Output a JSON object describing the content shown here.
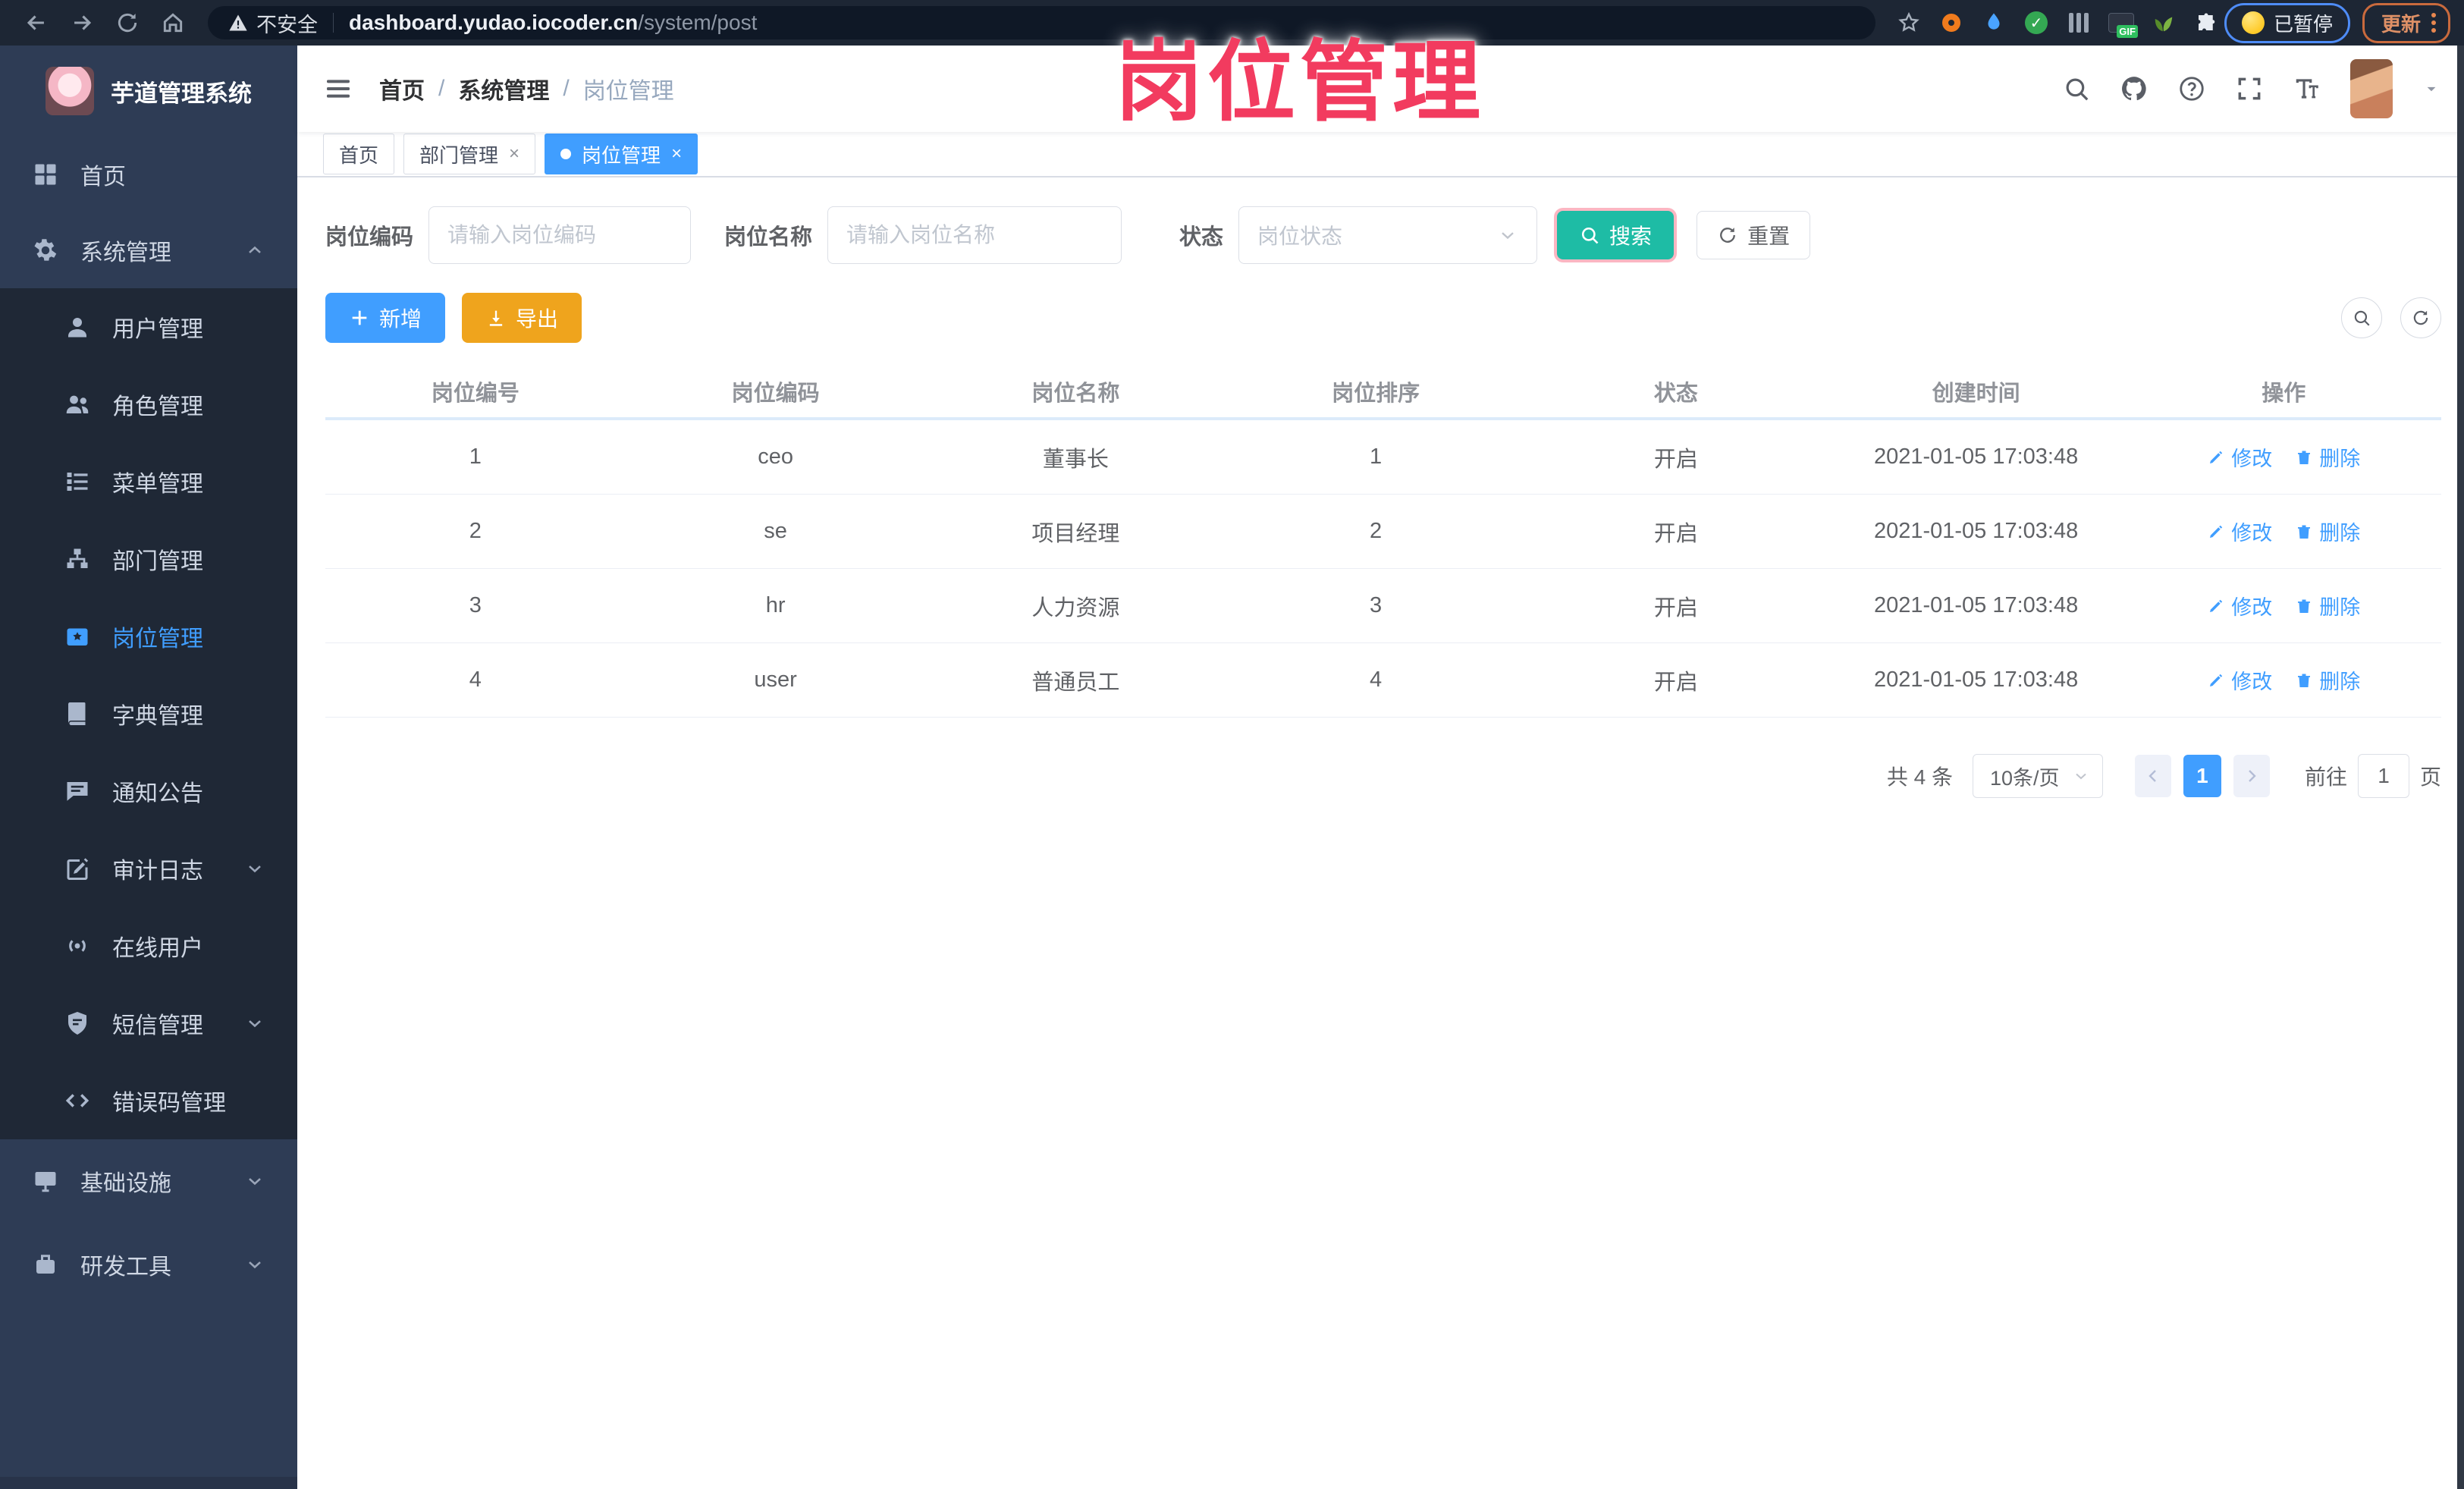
{
  "browser": {
    "security_label": "不安全",
    "url_host": "dashboard.yudao.iocoder.cn",
    "url_path": "/system/post",
    "paused_badge": "已暂停",
    "update_button": "更新"
  },
  "annotation": {
    "text": "岗位管理",
    "color": "#f23b5f"
  },
  "sidebar": {
    "title": "芋道管理系统",
    "items": [
      {
        "label": "首页",
        "icon": "dashboard",
        "zone": "top"
      },
      {
        "label": "系统管理",
        "icon": "gear",
        "zone": "top",
        "chevron": "up"
      },
      {
        "label": "用户管理",
        "icon": "user",
        "zone": "sub"
      },
      {
        "label": "角色管理",
        "icon": "role",
        "zone": "sub"
      },
      {
        "label": "菜单管理",
        "icon": "menu",
        "zone": "sub"
      },
      {
        "label": "部门管理",
        "icon": "dept",
        "zone": "sub"
      },
      {
        "label": "岗位管理",
        "icon": "post",
        "zone": "sub",
        "active": true
      },
      {
        "label": "字典管理",
        "icon": "dict",
        "zone": "sub"
      },
      {
        "label": "通知公告",
        "icon": "notice",
        "zone": "sub"
      },
      {
        "label": "审计日志",
        "icon": "audit",
        "zone": "sub",
        "chevron": "down"
      },
      {
        "label": "在线用户",
        "icon": "online",
        "zone": "sub"
      },
      {
        "label": "短信管理",
        "icon": "sms",
        "zone": "sub",
        "chevron": "down"
      },
      {
        "label": "错误码管理",
        "icon": "errcode",
        "zone": "sub"
      },
      {
        "label": "基础设施",
        "icon": "infra",
        "zone": "bottom",
        "chevron": "down"
      },
      {
        "label": "研发工具",
        "icon": "tools",
        "zone": "bottom",
        "chevron": "down"
      }
    ]
  },
  "breadcrumb": [
    "首页",
    "系统管理",
    "岗位管理"
  ],
  "tabs": [
    {
      "label": "首页",
      "closable": false,
      "active": false
    },
    {
      "label": "部门管理",
      "closable": true,
      "active": false
    },
    {
      "label": "岗位管理",
      "closable": true,
      "active": true
    }
  ],
  "filters": {
    "code_label": "岗位编码",
    "code_placeholder": "请输入岗位编码",
    "name_label": "岗位名称",
    "name_placeholder": "请输入岗位名称",
    "status_label": "状态",
    "status_placeholder": "岗位状态",
    "search_label": "搜索",
    "reset_label": "重置"
  },
  "toolbar": {
    "add_label": "新增",
    "export_label": "导出"
  },
  "table": {
    "columns": [
      "岗位编号",
      "岗位编码",
      "岗位名称",
      "岗位排序",
      "状态",
      "创建时间",
      "操作"
    ],
    "rows": [
      {
        "id": "1",
        "code": "ceo",
        "name": "董事长",
        "sort": "1",
        "status": "开启",
        "created": "2021-01-05 17:03:48"
      },
      {
        "id": "2",
        "code": "se",
        "name": "项目经理",
        "sort": "2",
        "status": "开启",
        "created": "2021-01-05 17:03:48"
      },
      {
        "id": "3",
        "code": "hr",
        "name": "人力资源",
        "sort": "3",
        "status": "开启",
        "created": "2021-01-05 17:03:48"
      },
      {
        "id": "4",
        "code": "user",
        "name": "普通员工",
        "sort": "4",
        "status": "开启",
        "created": "2021-01-05 17:03:48"
      }
    ],
    "actions": {
      "edit": "修改",
      "delete": "删除"
    }
  },
  "pagination": {
    "total_text": "共 4 条",
    "page_size": "10条/页",
    "current_page": "1",
    "goto_label": "前往",
    "goto_value": "1",
    "page_unit": "页"
  },
  "colors": {
    "accent": "#409EFF",
    "search": "#1ebca5",
    "export": "#efa41d",
    "annotation": "#f23b5f"
  }
}
